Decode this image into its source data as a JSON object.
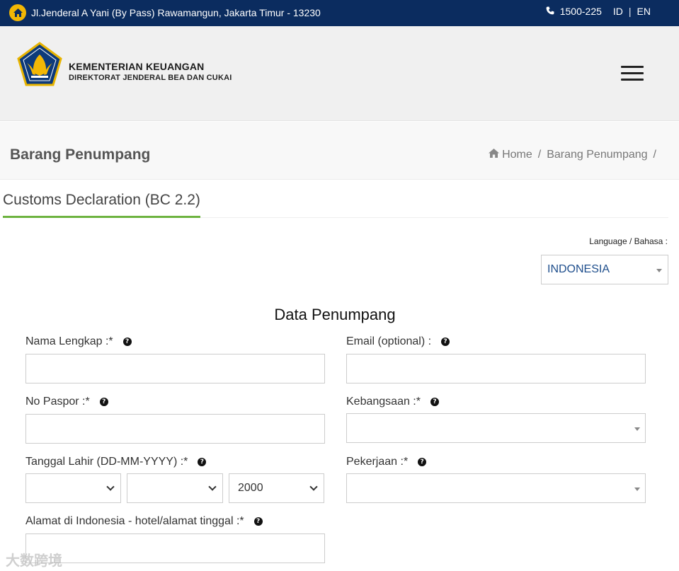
{
  "topbar": {
    "address": "Jl.Jenderal A Yani (By Pass) Rawamangun, Jakarta Timur - 13230",
    "phone": "1500-225",
    "lang_id": "ID",
    "separator": "|",
    "lang_en": "EN"
  },
  "brand": {
    "line1": "KEMENTERIAN KEUANGAN",
    "line2": "DIREKTORAT JENDERAL BEA DAN CUKAI"
  },
  "page": {
    "title": "Barang Penumpang",
    "breadcrumbs": [
      "Home",
      "Barang Penumpang"
    ],
    "crumb_sep": "/"
  },
  "tab": {
    "label": "Customs Declaration (BC 2.2)"
  },
  "language": {
    "label": "Language / Bahasa :",
    "selected": "INDONESIA"
  },
  "form": {
    "title": "Data Penumpang",
    "fields": {
      "nama": "Nama Lengkap :*",
      "email": "Email (optional) :",
      "paspor": "No Paspor :*",
      "kebangsaan": "Kebangsaan :*",
      "tanggal": "Tanggal Lahir (DD-MM-YYYY) :*",
      "pekerjaan": "Pekerjaan :*",
      "alamat": "Alamat di Indonesia - hotel/alamat tinggal :*"
    },
    "dob": {
      "day": "",
      "month": "",
      "year": "2000"
    }
  },
  "watermark": "大数跨境",
  "colors": {
    "topbar": "#0b2c5f",
    "accent_tab": "#6db33f",
    "home_badge": "#f2b705",
    "language_text": "#1e4e8c"
  }
}
